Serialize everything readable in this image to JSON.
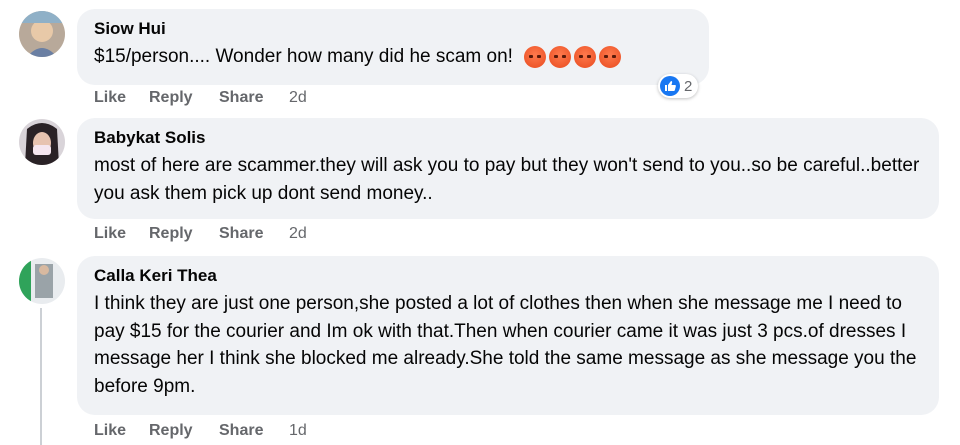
{
  "comments": [
    {
      "author": "Siow Hui",
      "text": "$15/person.... Wonder how many did he scam on!",
      "emojis": [
        "angry-face-icon",
        "angry-face-icon",
        "angry-face-icon",
        "angry-face-icon"
      ],
      "reaction_count": "2",
      "actions": {
        "like": "Like",
        "reply": "Reply",
        "share": "Share",
        "time": "2d"
      }
    },
    {
      "author": "Babykat Solis",
      "text": "most of here are scammer.they will ask you to pay but they won't send to you..so be careful..better you ask them pick up dont send money..",
      "actions": {
        "like": "Like",
        "reply": "Reply",
        "share": "Share",
        "time": "2d"
      }
    },
    {
      "author": "Calla Keri Thea",
      "text": "I think they are just one person,she posted a lot of clothes then when she message me I need to pay $15 for the courier and Im ok with that.Then when courier came it was just 3 pcs.of dresses I message her I think she blocked me already.She told the same message as she message you the before 9pm.",
      "actions": {
        "like": "Like",
        "reply": "Reply",
        "share": "Share",
        "time": "1d"
      }
    }
  ],
  "colors": {
    "bubble": "#f0f2f5",
    "meta": "#65676b",
    "text": "#050505",
    "like_blue": "#1877f2"
  }
}
